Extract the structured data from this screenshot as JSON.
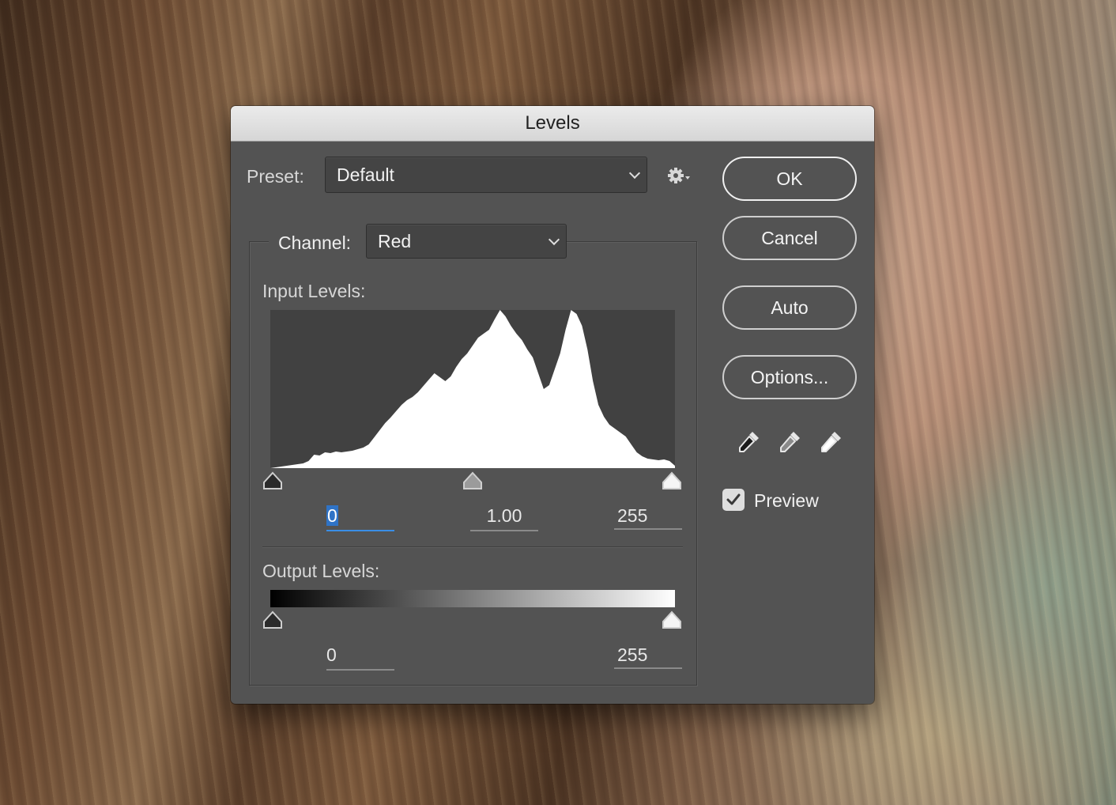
{
  "dialog": {
    "title": "Levels"
  },
  "preset": {
    "label": "Preset:",
    "value": "Default",
    "gear_icon": "gear-icon"
  },
  "channel": {
    "label": "Channel:",
    "value": "Red"
  },
  "input_levels": {
    "label": "Input Levels:",
    "black": "0",
    "gamma": "1.00",
    "white": "255"
  },
  "output_levels": {
    "label": "Output Levels:",
    "black": "0",
    "white": "255"
  },
  "buttons": {
    "ok": "OK",
    "cancel": "Cancel",
    "auto": "Auto",
    "options": "Options..."
  },
  "eyedroppers": [
    "black-point-eyedropper-icon",
    "gray-point-eyedropper-icon",
    "white-point-eyedropper-icon"
  ],
  "preview": {
    "label": "Preview",
    "checked": true
  },
  "colors": {
    "dialog_bg": "#535353",
    "histogram_bg": "#414141",
    "histogram_fill": "#ffffff",
    "focus_accent": "#3a8ee6"
  },
  "histogram_profile": [
    0,
    1,
    2,
    3,
    4,
    5,
    6,
    9,
    17,
    16,
    20,
    19,
    21,
    20,
    21,
    22,
    24,
    26,
    30,
    39,
    48,
    57,
    64,
    72,
    80,
    86,
    90,
    96,
    104,
    112,
    120,
    115,
    110,
    116,
    128,
    138,
    145,
    155,
    165,
    170,
    175,
    188,
    200,
    192,
    180,
    170,
    162,
    150,
    140,
    120,
    100,
    105,
    125,
    145,
    175,
    200,
    195,
    180,
    150,
    110,
    80,
    65,
    55,
    50,
    45,
    40,
    30,
    20,
    15,
    12,
    11,
    10,
    11,
    9,
    3
  ]
}
